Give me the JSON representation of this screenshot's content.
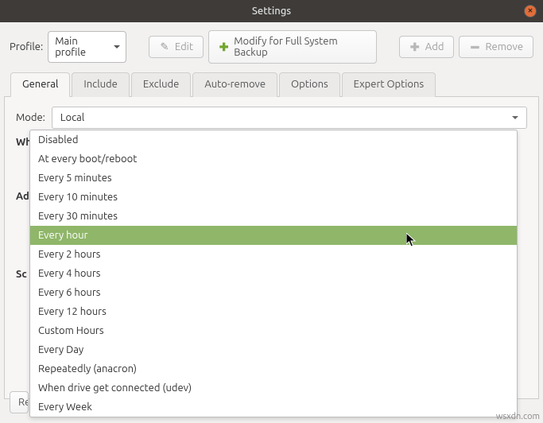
{
  "window": {
    "title": "Settings"
  },
  "toolbar": {
    "profile_label": "Profile:",
    "profile_value": "Main profile",
    "edit": "Edit",
    "modify": "Modify for Full System Backup",
    "add": "Add",
    "remove": "Remove"
  },
  "tabs": {
    "general": "General",
    "include": "Include",
    "exclude": "Exclude",
    "autoremove": "Auto-remove",
    "options": "Options",
    "expert": "Expert Options"
  },
  "content": {
    "mode_label": "Mode:",
    "mode_value": "Local",
    "where_label": "Where to save snapshots",
    "ad_label": "Ad",
    "sc_label": "Sc",
    "res_label": "Res"
  },
  "dropdown": {
    "items": [
      "Disabled",
      "At every boot/reboot",
      "Every 5 minutes",
      "Every 10 minutes",
      "Every 30 minutes",
      "Every hour",
      "Every 2 hours",
      "Every 4 hours",
      "Every 6 hours",
      "Every 12 hours",
      "Custom Hours",
      "Every Day",
      "Repeatedly (anacron)",
      "When drive get connected (udev)",
      "Every Week"
    ],
    "highlighted_index": 5
  },
  "watermark": "wsxdn.com"
}
